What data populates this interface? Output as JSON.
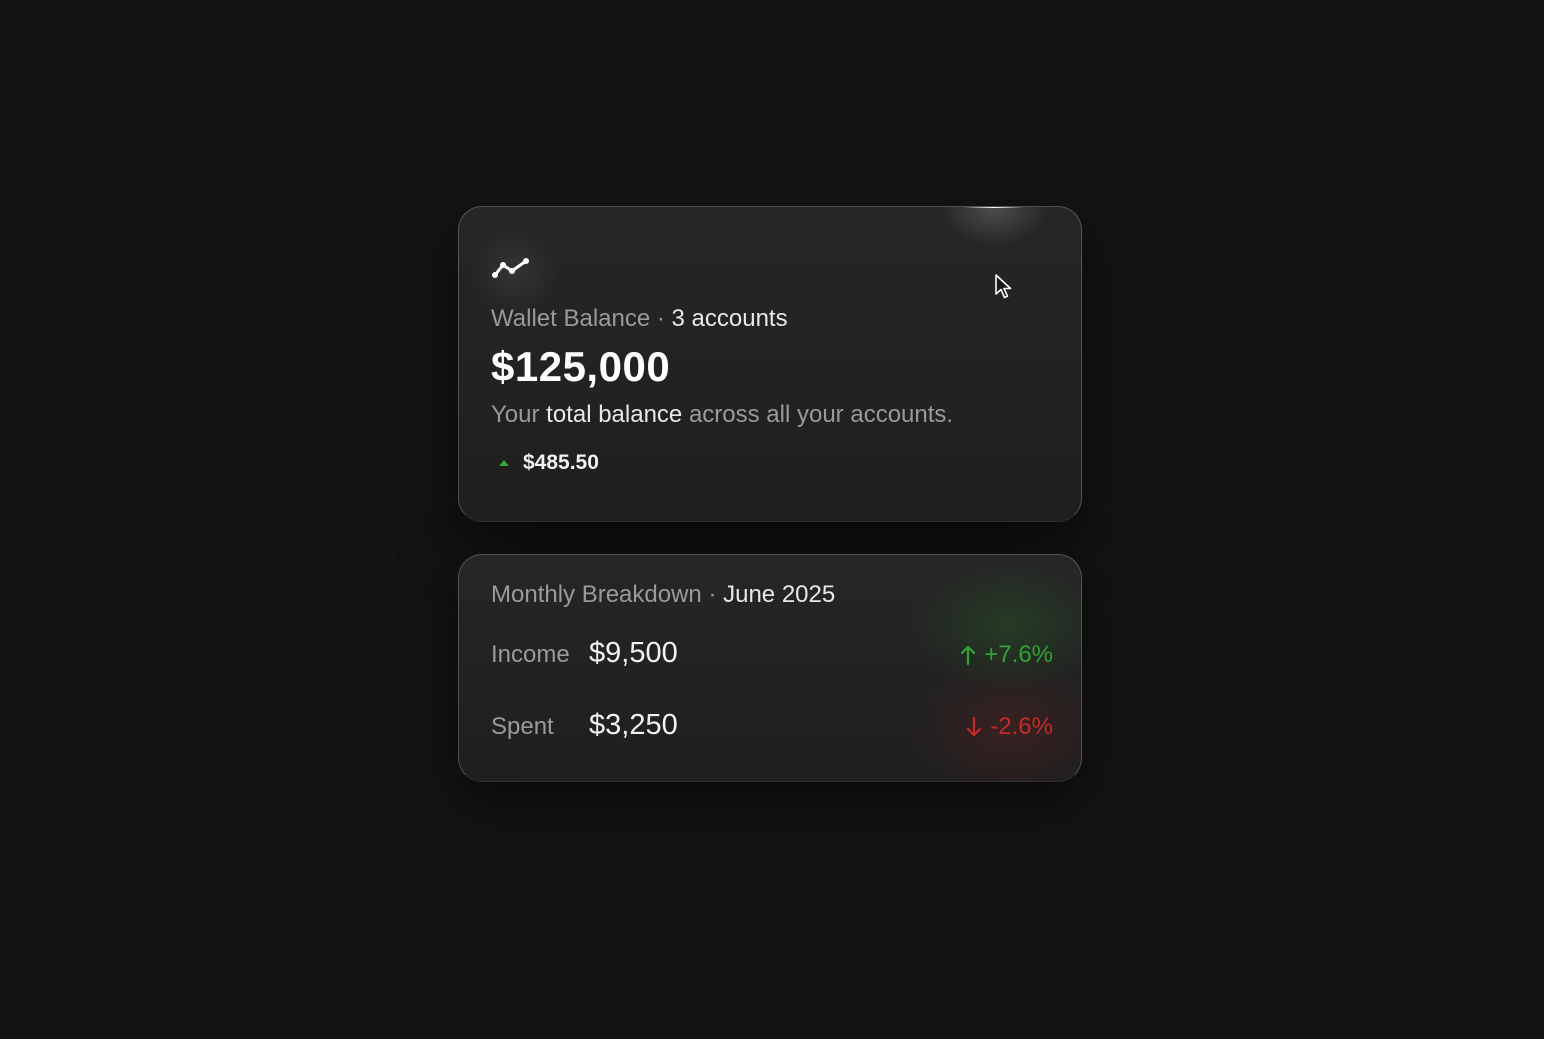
{
  "wallet": {
    "label": "Wallet Balance · ",
    "accounts": "3 accounts",
    "amount": "$125,000",
    "desc_prefix": "Your ",
    "desc_highlight": "total balance",
    "desc_suffix": " across all your accounts.",
    "change": "$485.50",
    "icons": {
      "trend": "trend-line-icon",
      "change": "caret-up-icon",
      "cursor": "mouse-pointer-icon"
    }
  },
  "monthly": {
    "label": "Monthly Breakdown · ",
    "period": "June 2025",
    "rows": [
      {
        "label": "Income",
        "value": "$9,500",
        "change": "+7.6%",
        "direction": "up",
        "icon": "arrow-up-icon"
      },
      {
        "label": "Spent",
        "value": "$3,250",
        "change": "-2.6%",
        "direction": "down",
        "icon": "arrow-down-icon"
      }
    ]
  },
  "colors": {
    "background": "#141414",
    "card": "#242424",
    "positive": "#34a132",
    "negative": "#c62a2a"
  }
}
